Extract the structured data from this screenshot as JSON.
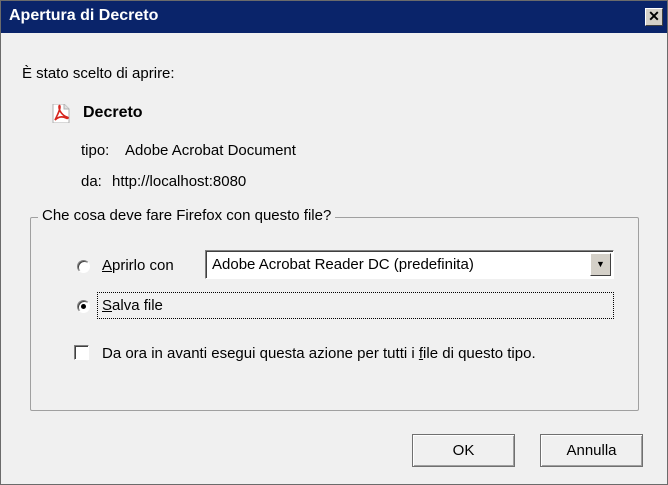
{
  "window": {
    "title": "Apertura di Decreto",
    "close_glyph": "✕"
  },
  "intro": {
    "text": "È stato scelto di aprire:"
  },
  "file": {
    "name": "Decreto",
    "icon": "pdf-icon",
    "type_label": "tipo:",
    "type_value": "Adobe Acrobat Document",
    "from_label": "da:",
    "from_value": "http://localhost:8080"
  },
  "action_group": {
    "legend": "Che cosa deve fare Firefox con questo file?",
    "open_with": {
      "label_accel": "A",
      "label_rest": "prirlo con",
      "selected": false,
      "app": "Adobe Acrobat Reader DC  (predefinita)"
    },
    "save_file": {
      "label_accel": "S",
      "label_rest": "alva file",
      "selected": true
    },
    "remember": {
      "label_pre": "Da ora in avanti esegui questa azione per tutti i ",
      "label_accel": "f",
      "label_post": "ile di questo tipo.",
      "checked": false
    }
  },
  "buttons": {
    "ok": "OK",
    "cancel": "Annulla"
  }
}
